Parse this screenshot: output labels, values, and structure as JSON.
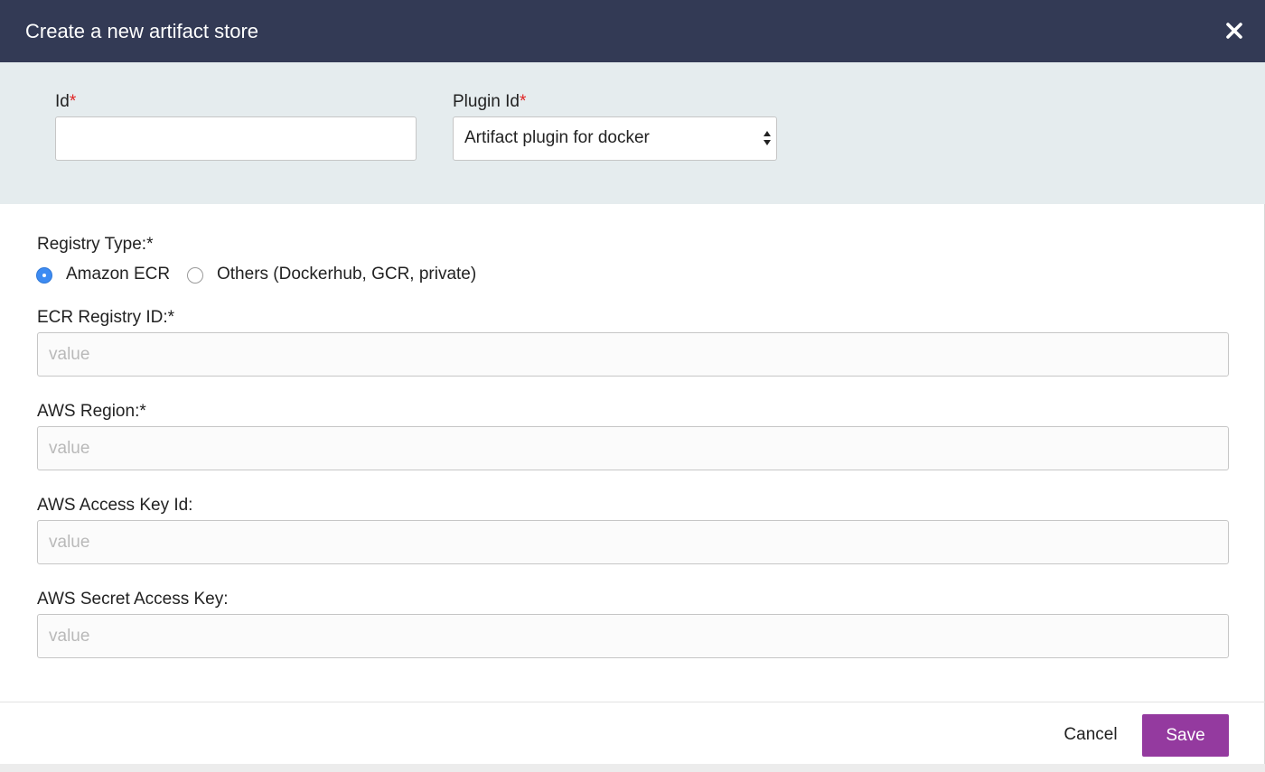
{
  "dialog": {
    "title": "Create a new artifact store",
    "close_icon": "close-icon"
  },
  "top_fields": {
    "id_label": "Id",
    "required_mark": "*",
    "id_value": "",
    "plugin_label": "Plugin Id",
    "plugin_selected": "Artifact plugin for docker"
  },
  "registry": {
    "type_label": "Registry Type:*",
    "options": [
      {
        "label": "Amazon ECR",
        "selected": true
      },
      {
        "label": "Others (Dockerhub, GCR, private)",
        "selected": false
      }
    ]
  },
  "fields": [
    {
      "label": "ECR Registry ID:*",
      "placeholder": "value"
    },
    {
      "label": "AWS Region:*",
      "placeholder": "value"
    },
    {
      "label": "AWS Access Key Id:",
      "placeholder": "value"
    },
    {
      "label": "AWS Secret Access Key:",
      "placeholder": "value"
    }
  ],
  "footer": {
    "cancel_label": "Cancel",
    "save_label": "Save"
  },
  "colors": {
    "header_bg": "#333a55",
    "section_bg": "#e5ecee",
    "save_bg": "#943a9f",
    "radio_selected": "#3d8bf2",
    "required": "#e02424"
  }
}
